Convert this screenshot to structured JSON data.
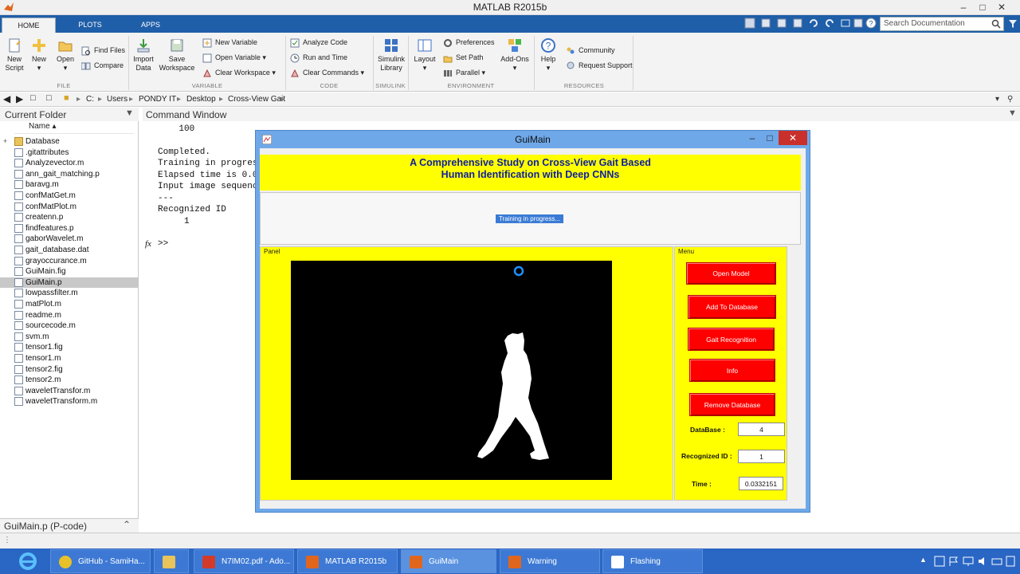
{
  "window": {
    "title": "MATLAB R2015b"
  },
  "tabs": [
    {
      "label": "HOME"
    },
    {
      "label": "PLOTS"
    },
    {
      "label": "APPS"
    }
  ],
  "search": {
    "placeholder": "Search Documentation"
  },
  "ribbon": {
    "file": {
      "group": "FILE",
      "new_script": "New\nScript",
      "new_script_l1": "New",
      "new_script_l2": "Script",
      "new": "New",
      "open": "Open",
      "find_files": "Find Files",
      "compare": "Compare"
    },
    "variable": {
      "group": "VARIABLE",
      "import_l1": "Import",
      "import_l2": "Data",
      "save_l1": "Save",
      "save_l2": "Workspace",
      "new_variable": "New Variable",
      "open_variable": "Open Variable",
      "clear_workspace": "Clear Workspace"
    },
    "code": {
      "group": "CODE",
      "analyze": "Analyze Code",
      "run_time": "Run and Time",
      "clear_commands": "Clear Commands"
    },
    "simulink": {
      "group": "SIMULINK",
      "l1": "Simulink",
      "l2": "Library"
    },
    "environment": {
      "group": "ENVIRONMENT",
      "layout": "Layout",
      "preferences": "Preferences",
      "set_path": "Set Path",
      "parallel": "Parallel",
      "addons": "Add-Ons"
    },
    "resources": {
      "group": "RESOURCES",
      "help": "Help",
      "community": "Community",
      "request_support": "Request Support"
    }
  },
  "address": {
    "crumbs": [
      "C:",
      "Users",
      "PONDY IT",
      "Desktop",
      "Cross-View Gait"
    ]
  },
  "current_folder": {
    "title": "Current Folder",
    "name_header": "Name ▴",
    "files": [
      "Database",
      ".gitattributes",
      "Analyzevector.m",
      "ann_gait_matching.p",
      "baravg.m",
      "confMatGet.m",
      "confMatPlot.m",
      "createnn.p",
      "findfeatures.p",
      "gaborWavelet.m",
      "gait_database.dat",
      "grayoccurance.m",
      "GuiMain.fig",
      "GuiMain.p",
      "lowpassfilter.m",
      "matPlot.m",
      "readme.m",
      "sourcecode.m",
      "svm.m",
      "tensor1.fig",
      "tensor1.m",
      "tensor2.fig",
      "tensor2.m",
      "waveletTransfor.m",
      "waveletTransform.m"
    ],
    "selected_index": 13,
    "footer": "GuiMain.p  (P-code)"
  },
  "command_window": {
    "title": "Command Window",
    "lines": [
      "    100",
      "",
      "Completed.",
      "Training in progres",
      "Elapsed time is 0.0",
      "Input image sequenc",
      "---",
      "Recognized ID",
      "     1"
    ],
    "prompt": ">>",
    "fx": "fx"
  },
  "gui": {
    "title": "GuiMain",
    "banner_l1": "A Comprehensive Study on Cross-View Gait Based",
    "banner_l2": "Human Identification with Deep CNNs",
    "progress_text": "Training in progress...",
    "panel_label": "Panel",
    "menu_label": "Menu",
    "buttons": {
      "open_model": "Open Model",
      "add_db": "Add To Database",
      "gait_recog": "Gait Recognition",
      "info": "Info",
      "remove_db": "Remove Database"
    },
    "fields": {
      "database_label": "DataBase :",
      "database_value": "4",
      "recognized_label": "Recognized  ID :",
      "recognized_value": "1",
      "time_label": "Time :",
      "time_value": "0.0332151"
    }
  },
  "taskbar": {
    "items": [
      {
        "label": "GitHub - SamiHa...",
        "icon": "chrome-icon"
      },
      {
        "label": "",
        "icon": "folder-icon"
      },
      {
        "label": "N7IM02.pdf - Ado...",
        "icon": "pdf-icon"
      },
      {
        "label": "MATLAB R2015b",
        "icon": "matlab-icon"
      },
      {
        "label": "GuiMain",
        "icon": "matlab-icon"
      },
      {
        "label": "Warning",
        "icon": "matlab-icon"
      },
      {
        "label": "Flashing",
        "icon": "document-icon"
      }
    ]
  },
  "colors": {
    "banner_bg": "#ffff00",
    "banner_text": "#0e1ea0",
    "button_red": "#ff0000",
    "taskbar": "#2a66c4",
    "tab_bar": "#1f5ea8"
  }
}
